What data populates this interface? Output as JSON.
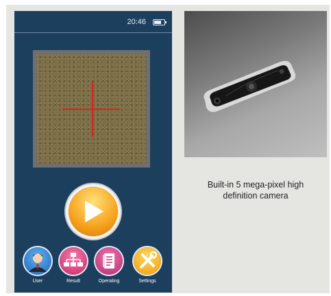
{
  "phone": {
    "status_time": "20:46",
    "battery_level": 0.7,
    "bottom_nav": [
      {
        "label": "User",
        "icon": "user-icon",
        "color": "#2f7fd0"
      },
      {
        "label": "Result",
        "icon": "result-icon",
        "color": "#e0407f"
      },
      {
        "label": "Operating",
        "icon": "operating-icon",
        "color": "#d43d88"
      },
      {
        "label": "Settings",
        "icon": "settings-icon",
        "color": "#f4b30c"
      }
    ]
  },
  "caption": {
    "line1": "Built-in 5 mega-pixel high",
    "line2": "definition camera"
  },
  "colors": {
    "panel_bg": "#1d3f5e",
    "crosshair": "#d8241d",
    "play": "#f6a21b"
  }
}
